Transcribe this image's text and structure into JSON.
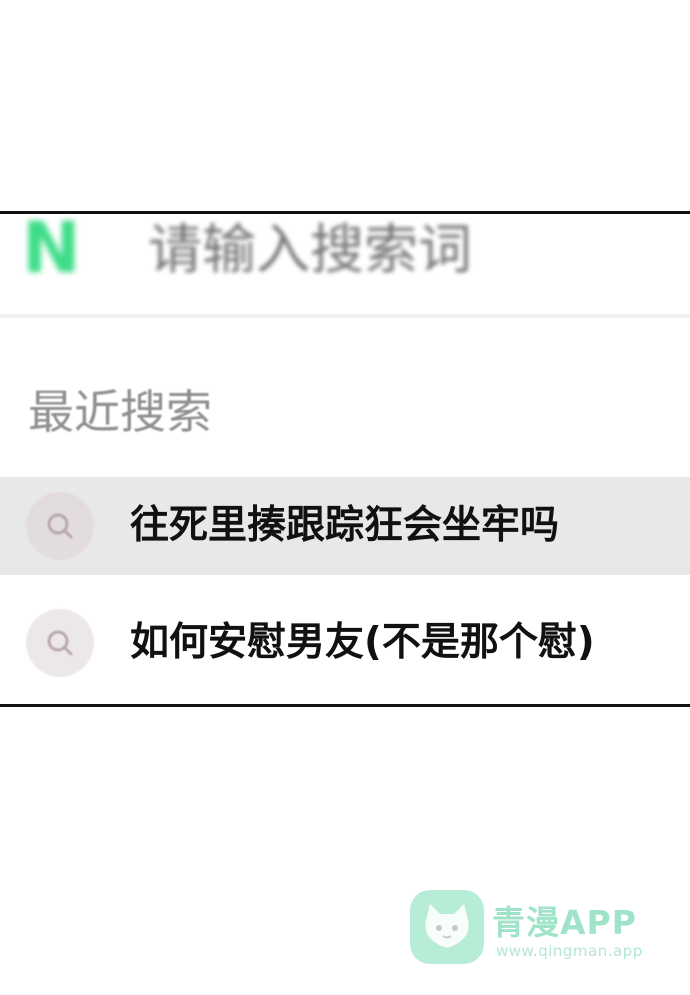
{
  "search": {
    "logo_letter": "N",
    "placeholder": "请输入搜索词"
  },
  "recent": {
    "title": "最近搜索",
    "items": [
      {
        "text": "往死里揍跟踪狂会坐牢吗",
        "highlighted": true
      },
      {
        "text": "如何安慰男友(不是那个慰)",
        "highlighted": false
      }
    ]
  },
  "watermark": {
    "name": "青漫APP",
    "url": "www.qingman.app"
  },
  "colors": {
    "brand_green": "#2ad97c",
    "highlight_row": "#e8e8e8",
    "placeholder_gray": "#cfcfcf"
  }
}
